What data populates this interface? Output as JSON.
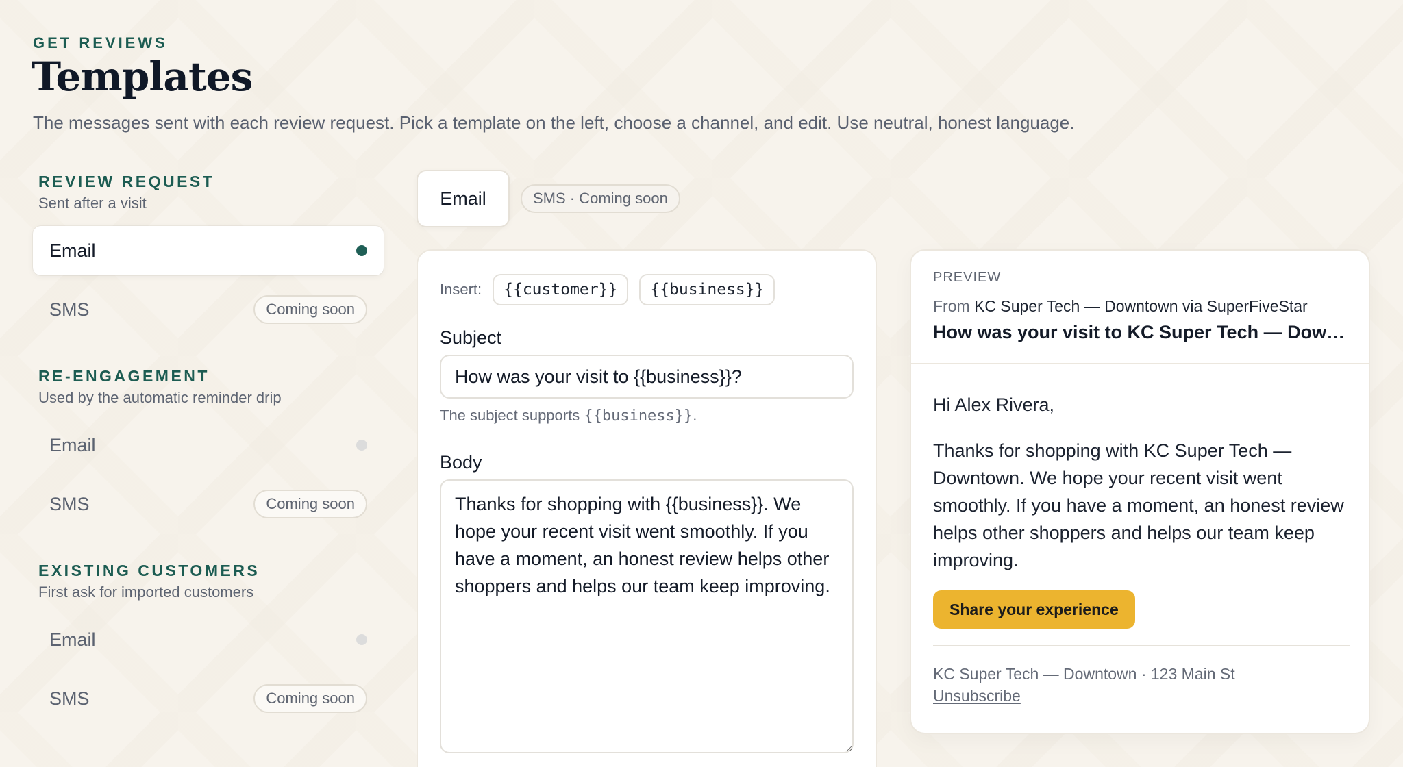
{
  "header": {
    "eyebrow": "GET REVIEWS",
    "title": "Templates",
    "subtitle": "The messages sent with each review request. Pick a template on the left, choose a channel, and edit. Use neutral, honest language."
  },
  "sidebar": {
    "groups": [
      {
        "title": "REVIEW REQUEST",
        "description": "Sent after a visit",
        "items": [
          {
            "label": "Email",
            "state": "active"
          },
          {
            "label": "SMS",
            "badge": "Coming soon"
          }
        ]
      },
      {
        "title": "RE-ENGAGEMENT",
        "description": "Used by the automatic reminder drip",
        "items": [
          {
            "label": "Email"
          },
          {
            "label": "SMS",
            "badge": "Coming soon"
          }
        ]
      },
      {
        "title": "EXISTING CUSTOMERS",
        "description": "First ask for imported customers",
        "items": [
          {
            "label": "Email"
          },
          {
            "label": "SMS",
            "badge": "Coming soon"
          }
        ]
      }
    ]
  },
  "channels": {
    "email": "Email",
    "sms": "SMS · Coming soon"
  },
  "editor": {
    "insert_label": "Insert:",
    "chips": [
      "{{customer}}",
      "{{business}}"
    ],
    "subject_label": "Subject",
    "subject_value": "How was your visit to {{business}}?",
    "subject_hint_prefix": "The subject supports ",
    "subject_hint_token": "{{business}}",
    "subject_hint_suffix": ".",
    "body_label": "Body",
    "body_value": "Thanks for shopping with {{business}}. We hope your recent visit went smoothly. If you have a moment, an honest review helps other shoppers and helps our team keep improving."
  },
  "preview": {
    "tag": "PREVIEW",
    "from_prefix": "From",
    "from_value": "KC Super Tech — Downtown via SuperFiveStar",
    "subject": "How was your visit to KC Super Tech — Downtown?",
    "greeting": "Hi Alex Rivera,",
    "body": "Thanks for shopping with KC Super Tech — Downtown. We hope your recent visit went smoothly. If you have a moment, an honest review helps other shoppers and helps our team keep improving.",
    "cta": "Share your experience",
    "footer_address": "KC Super Tech — Downtown · 123 Main St",
    "unsubscribe": "Unsubscribe"
  },
  "colors": {
    "accent": "#1c5c52",
    "cta": "#ecb42f",
    "background": "#f7f3ec"
  }
}
